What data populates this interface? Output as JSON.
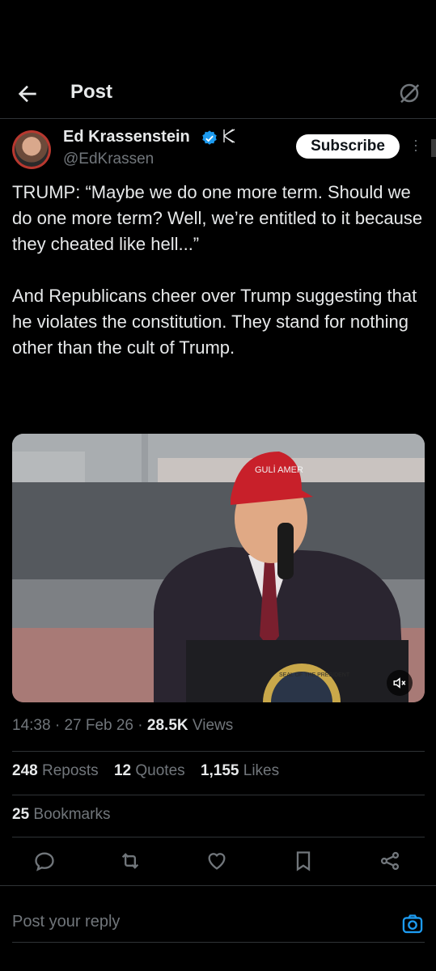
{
  "header": {
    "title": "Post",
    "back_icon": "arrow-left-icon",
    "grok_icon": "grok-icon"
  },
  "author": {
    "name": "Ed Krassenstein",
    "affiliate_mark": "🇰",
    "handle": "@EdKrassen",
    "subscribe_label": "Subscribe",
    "verified_color": "#1d9bf0"
  },
  "post": {
    "paragraph1": "TRUMP: “Maybe we do one more term. Should we do one more term? Well, we’re entitled to it because they cheated like hell...”",
    "paragraph2": "And Republicans cheer over Trump suggesting that he violates the constitution. They stand for nothing other than the cult of Trump."
  },
  "media": {
    "type": "video",
    "hat_text": "GULİ AMER",
    "seal_text": "SEAL OF THE PRESIDENT",
    "mute_icon": "speaker-muted-icon"
  },
  "meta": {
    "time": "14:38",
    "date": "27 Feb 26",
    "views_count": "28.5K",
    "views_label": "Views"
  },
  "stats": {
    "reposts_count": "248",
    "reposts_label": "Reposts",
    "quotes_count": "12",
    "quotes_label": "Quotes",
    "likes_count": "1,155",
    "likes_label": "Likes",
    "bookmarks_count": "25",
    "bookmarks_label": "Bookmarks"
  },
  "actions": [
    "reply-icon",
    "repost-icon",
    "like-icon",
    "bookmark-icon",
    "share-icon"
  ],
  "reply": {
    "placeholder": "Post your reply",
    "camera_icon": "camera-icon",
    "accent": "#1d9bf0"
  }
}
